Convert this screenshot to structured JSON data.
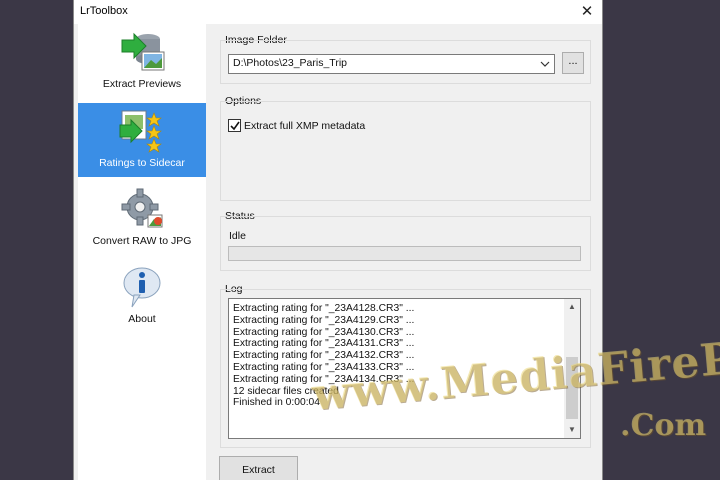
{
  "window": {
    "title": "LrToolbox",
    "close_glyph": "✕"
  },
  "sidebar": {
    "items": [
      {
        "label": "Extract Previews",
        "icon": "database-image-icon",
        "active": false
      },
      {
        "label": "Ratings to Sidecar",
        "icon": "stars-icon",
        "active": true
      },
      {
        "label": "Convert RAW to JPG",
        "icon": "gear-icon",
        "active": false
      },
      {
        "label": "About",
        "icon": "info-icon",
        "active": false
      }
    ]
  },
  "image_folder": {
    "label": "Image Folder",
    "value": "D:\\Photos\\23_Paris_Trip",
    "browse_label": "..."
  },
  "options": {
    "label": "Options",
    "xmp_label": "Extract full XMP metadata",
    "xmp_checked": true
  },
  "status": {
    "label": "Status",
    "text": "Idle",
    "progress": 0
  },
  "log": {
    "label": "Log",
    "lines": [
      "Extracting rating for \"_23A4128.CR3\" ...",
      "Extracting rating for \"_23A4129.CR3\" ...",
      "Extracting rating for \"_23A4130.CR3\" ...",
      "Extracting rating for \"_23A4131.CR3\" ...",
      "Extracting rating for \"_23A4132.CR3\" ...",
      "Extracting rating for \"_23A4133.CR3\" ...",
      "Extracting rating for \"_23A4134.CR3\" ...",
      "12 sidecar files created",
      "Finished in 0:00:04"
    ]
  },
  "actions": {
    "extract_label": "Extract"
  },
  "watermark": {
    "main": "www.MediaFirePC",
    "sub": ".Com"
  },
  "colors": {
    "accent": "#3a8ee6",
    "background": "#3b3746"
  }
}
